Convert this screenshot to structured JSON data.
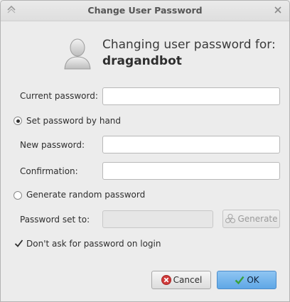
{
  "window": {
    "title": "Change User Password"
  },
  "header": {
    "line1": "Changing user password for:",
    "username": "dragandbot"
  },
  "form": {
    "current_password_label": "Current password:",
    "current_password_value": "",
    "set_by_hand_label": "Set password by hand",
    "set_by_hand_selected": true,
    "new_password_label": "New password:",
    "new_password_value": "",
    "confirmation_label": "Confirmation:",
    "confirmation_value": "",
    "generate_random_label": "Generate random password",
    "generate_random_selected": false,
    "password_set_to_label": "Password set to:",
    "password_set_to_value": "",
    "generate_button": "Generate",
    "dont_ask_label": "Don't ask for password on login",
    "dont_ask_checked": true
  },
  "buttons": {
    "cancel": "Cancel",
    "ok": "OK"
  },
  "icons": {
    "app": "window-icon",
    "close": "close-icon",
    "avatar": "user-avatar-icon",
    "generate": "generate-icon",
    "cancel": "cancel-icon",
    "ok": "checkmark-icon"
  },
  "colors": {
    "ok_button": "#6aaeea",
    "cancel_icon": "#d03a3a",
    "ok_icon": "#3aa13a"
  }
}
